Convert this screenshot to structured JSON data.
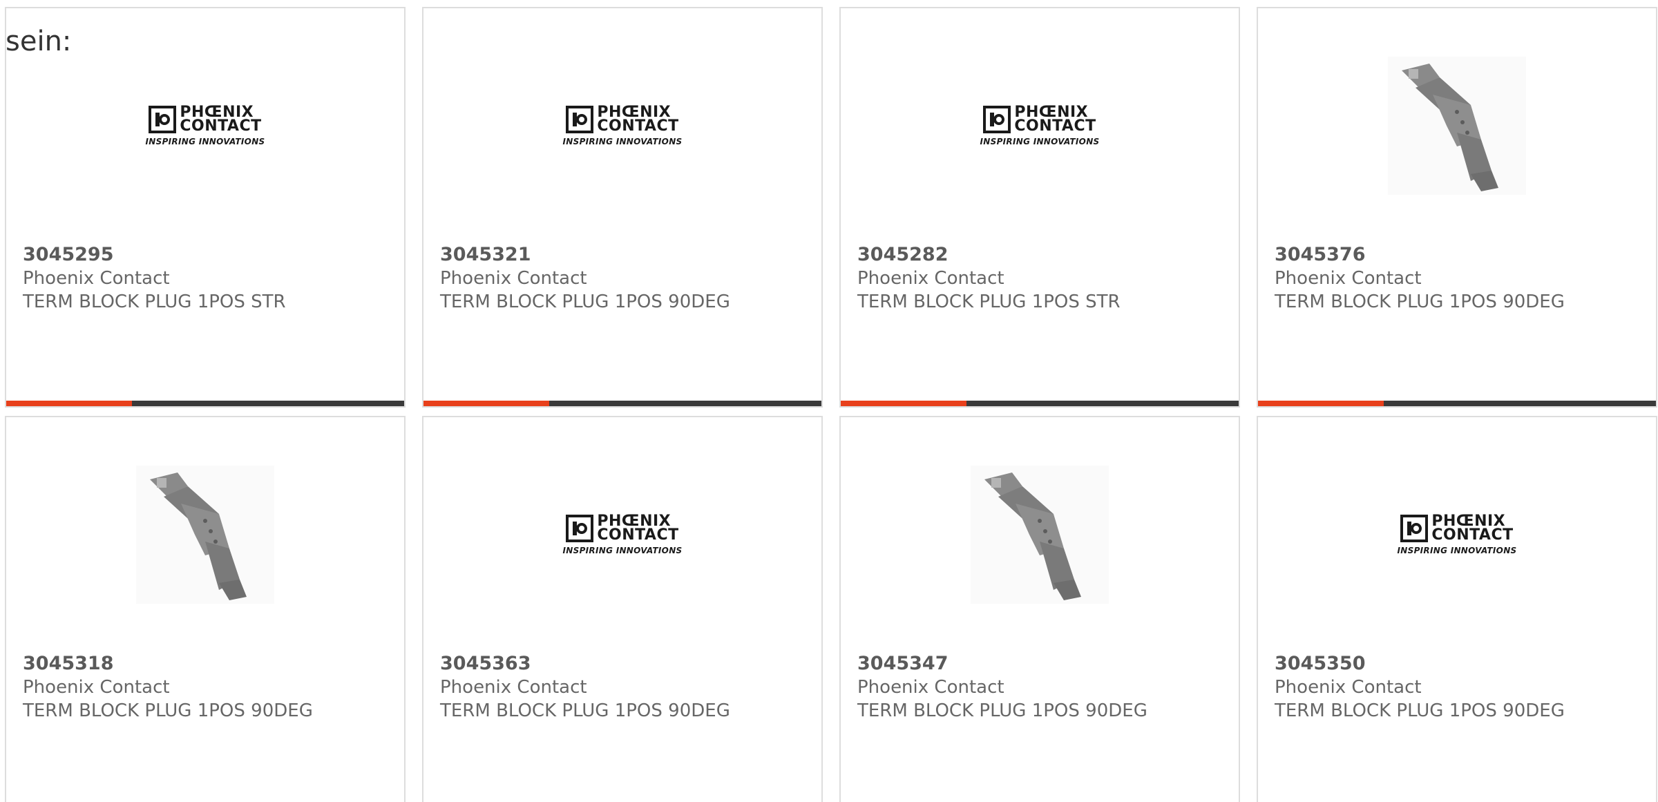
{
  "lead_text": "sein:",
  "colors": {
    "accent": "#e8401c",
    "bar": "#3a3a3a",
    "card_border": "#dddddd",
    "part_number": "#5a5a5a",
    "meta_text": "#666666"
  },
  "logo": {
    "line1": "PHŒNIX",
    "line2": "CONTACT",
    "tagline": "INSPIRING INNOVATIONS"
  },
  "products": [
    {
      "part_number": "3045295",
      "manufacturer": "Phoenix Contact",
      "description": "TERM BLOCK PLUG 1POS STR",
      "image": "phoenix-contact-logo"
    },
    {
      "part_number": "3045321",
      "manufacturer": "Phoenix Contact",
      "description": "TERM BLOCK PLUG 1POS 90DEG",
      "image": "phoenix-contact-logo"
    },
    {
      "part_number": "3045282",
      "manufacturer": "Phoenix Contact",
      "description": "TERM BLOCK PLUG 1POS STR",
      "image": "phoenix-contact-logo"
    },
    {
      "part_number": "3045376",
      "manufacturer": "Phoenix Contact",
      "description": "TERM BLOCK PLUG 1POS 90DEG",
      "image": "terminal-block-plug-photo"
    },
    {
      "part_number": "3045318",
      "manufacturer": "Phoenix Contact",
      "description": "TERM BLOCK PLUG 1POS 90DEG",
      "image": "terminal-block-plug-photo"
    },
    {
      "part_number": "3045363",
      "manufacturer": "Phoenix Contact",
      "description": "TERM BLOCK PLUG 1POS 90DEG",
      "image": "phoenix-contact-logo"
    },
    {
      "part_number": "3045347",
      "manufacturer": "Phoenix Contact",
      "description": "TERM BLOCK PLUG 1POS 90DEG",
      "image": "terminal-block-plug-photo"
    },
    {
      "part_number": "3045350",
      "manufacturer": "Phoenix Contact",
      "description": "TERM BLOCK PLUG 1POS 90DEG",
      "image": "phoenix-contact-logo"
    }
  ]
}
